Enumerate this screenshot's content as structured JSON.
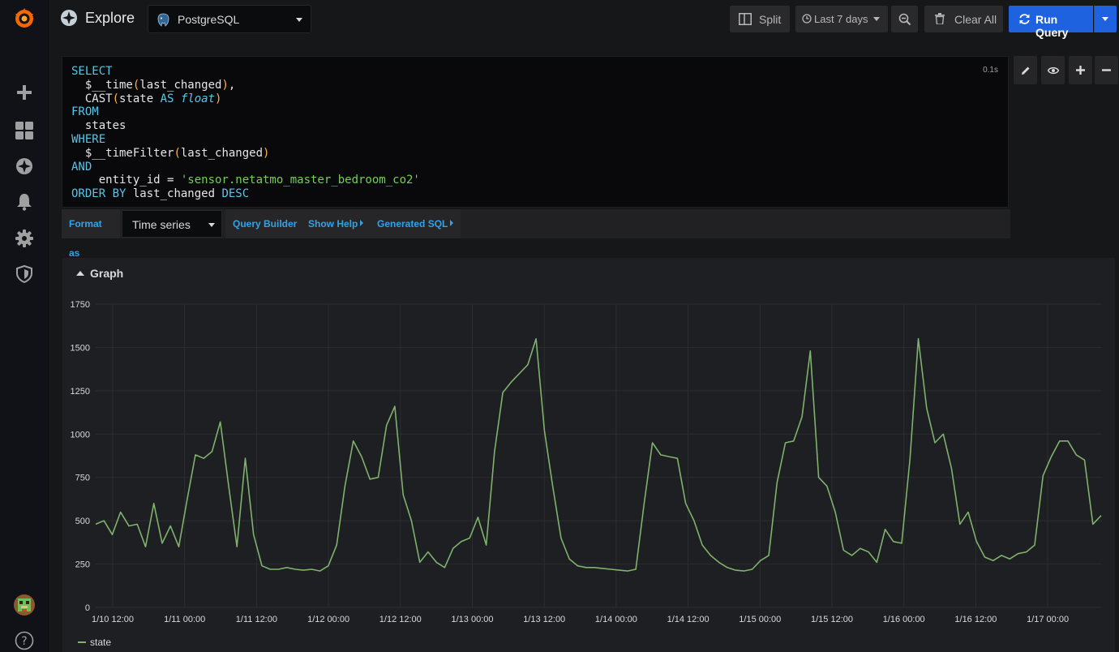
{
  "sidebar": {
    "items": [
      {
        "icon": "grafana-logo-icon"
      },
      {
        "icon": "plus-icon"
      },
      {
        "icon": "dashboards-icon"
      },
      {
        "icon": "explore-icon"
      },
      {
        "icon": "bell-icon"
      },
      {
        "icon": "gear-icon"
      },
      {
        "icon": "shield-icon"
      },
      {
        "icon": "user-avatar"
      },
      {
        "icon": "help-icon"
      }
    ]
  },
  "header": {
    "title": "Explore",
    "datasource": "PostgreSQL",
    "split_label": "Split",
    "time_range": "Last 7 days",
    "clear_label": "Clear All",
    "run_label": "Run Query"
  },
  "editor": {
    "query_time": "0.1s",
    "lines": [
      "SELECT",
      "  $__time(last_changed),",
      "  CAST(state AS float)",
      "FROM",
      "  states",
      "WHERE",
      "  $__timeFilter(last_changed)",
      "AND",
      "    entity_id = 'sensor.netatmo_master_bedroom_co2'",
      "ORDER BY last_changed DESC"
    ]
  },
  "query_options": {
    "format_label": "Format as",
    "format_value": "Time series",
    "builder_label": "Query Builder",
    "help_label": "Show Help",
    "sql_label": "Generated SQL"
  },
  "graph_panel": {
    "title": "Graph"
  },
  "colors": {
    "accent": "#1f62e0",
    "link": "#33a2e5",
    "series": "#7eb26d"
  },
  "chart_data": {
    "type": "line",
    "xlabel": "",
    "ylabel": "",
    "ylim": [
      0,
      1750
    ],
    "y_ticks": [
      0,
      250,
      500,
      750,
      1000,
      1250,
      1500,
      1750
    ],
    "x_tick_labels": [
      "1/10 12:00",
      "1/11 00:00",
      "1/11 12:00",
      "1/12 00:00",
      "1/12 12:00",
      "1/13 00:00",
      "1/13 12:00",
      "1/14 00:00",
      "1/14 12:00",
      "1/15 00:00",
      "1/15 12:00",
      "1/16 00:00",
      "1/16 12:00",
      "1/17 00:00"
    ],
    "x_start": "1/10 12:00",
    "x_step_hours": 2,
    "x_last": "1/17 14:00",
    "grid": true,
    "legend_position": "bottom-left",
    "series": [
      {
        "name": "state",
        "color": "#7eb26d",
        "values": [
          480,
          500,
          420,
          550,
          470,
          480,
          350,
          600,
          370,
          470,
          350,
          620,
          880,
          860,
          900,
          1070,
          700,
          350,
          860,
          420,
          240,
          220,
          220,
          230,
          220,
          215,
          220,
          210,
          240,
          360,
          700,
          960,
          870,
          740,
          750,
          1050,
          1160,
          650,
          500,
          260,
          320,
          260,
          230,
          340,
          380,
          400,
          520,
          360,
          900,
          1240,
          1300,
          1350,
          1400,
          1550,
          1020,
          700,
          400,
          280,
          240,
          230,
          230,
          225,
          220,
          215,
          210,
          220,
          600,
          950,
          880,
          870,
          860,
          600,
          500,
          360,
          300,
          260,
          230,
          215,
          210,
          220,
          270,
          300,
          720,
          950,
          960,
          1100,
          1480,
          750,
          700,
          550,
          330,
          300,
          340,
          320,
          260,
          450,
          380,
          370,
          860,
          1550,
          1150,
          950,
          1000,
          800,
          480,
          550,
          380,
          290,
          270,
          300,
          280,
          310,
          320,
          360,
          760,
          870,
          960,
          960,
          880,
          850,
          480,
          530
        ]
      }
    ]
  }
}
